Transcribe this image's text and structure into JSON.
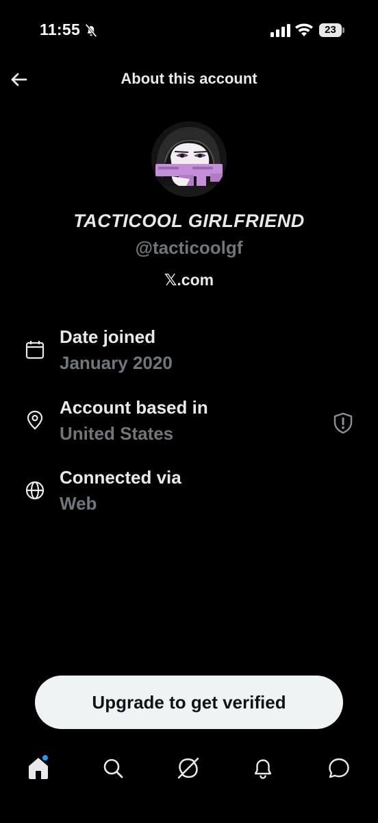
{
  "status_bar": {
    "time": "11:55",
    "battery_level": "23",
    "icons": [
      "bell-off-icon",
      "signal-icon",
      "wifi-icon",
      "battery-icon"
    ]
  },
  "header": {
    "title": "About this account",
    "back_icon": "arrow-left-icon"
  },
  "profile": {
    "display_name": "TACTICOOL GIRLFRIEND",
    "handle": "@tacticoolgf",
    "website": "𝕏.com"
  },
  "info": {
    "date_joined": {
      "label": "Date joined",
      "value": "January 2020",
      "icon": "calendar-icon"
    },
    "account_based": {
      "label": "Account based in",
      "value": "United States",
      "icon": "location-pin-icon",
      "trailing_icon": "shield-exclamation-icon"
    },
    "connected_via": {
      "label": "Connected via",
      "value": "Web",
      "icon": "globe-icon"
    }
  },
  "upgrade_button": {
    "label": "Upgrade to get verified"
  },
  "bottom_nav": {
    "items": [
      "home-icon",
      "search-icon",
      "grok-icon",
      "notifications-icon",
      "messages-icon"
    ],
    "active": "home-icon"
  },
  "colors": {
    "background": "#000000",
    "text_primary": "#e7e9ea",
    "text_secondary": "#71767b",
    "notification_dot": "#1d9bf0",
    "button_bg": "#eff3f4",
    "avatar_accent": "#c48fd6"
  }
}
